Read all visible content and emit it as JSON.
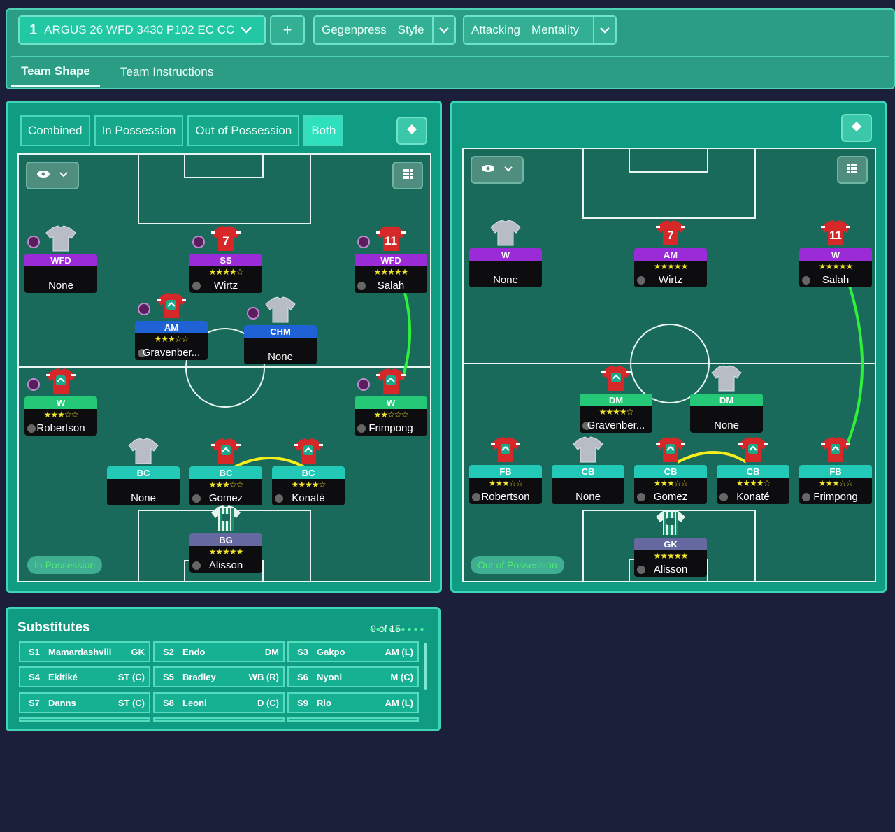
{
  "header": {
    "tactic_num": "1",
    "tactic_name": "ARGUS 26 WFD 3430 P102 EC CC",
    "plus": "+",
    "style_a": "Gegenpress",
    "style_b": "Style",
    "ment_a": "Attacking",
    "ment_b": "Mentality"
  },
  "tabs": [
    "Team Shape",
    "Team Instructions"
  ],
  "modes": [
    "Combined",
    "In Possession",
    "Out of Possession",
    "Both"
  ],
  "left_state": "In Possession",
  "right_state": "Out of Possession",
  "left_cards": [
    {
      "role": "WFD",
      "name": "None",
      "stars": "",
      "color": "purple",
      "shirt": "grey",
      "num": "",
      "dot": true
    },
    {
      "role": "SS",
      "name": "Wirtz",
      "stars": "★★★★☆",
      "color": "purple",
      "shirt": "red",
      "num": "7",
      "dot": true
    },
    {
      "role": "WFD",
      "name": "Salah",
      "stars": "★★★★★",
      "color": "purple",
      "shirt": "red",
      "num": "11",
      "dot": true
    },
    {
      "role": "AM",
      "name": "Gravenber...",
      "stars": "★★★☆☆",
      "color": "blue",
      "shirt": "red",
      "num": "",
      "dot": true
    },
    {
      "role": "CHM",
      "name": "None",
      "stars": "",
      "color": "blue",
      "shirt": "grey",
      "num": "",
      "dot": true
    },
    {
      "role": "W",
      "name": "Robertson",
      "stars": "★★★☆☆",
      "color": "green",
      "shirt": "red",
      "num": "",
      "dot": true
    },
    {
      "role": "W",
      "name": "Frimpong",
      "stars": "★★☆☆☆",
      "color": "green",
      "shirt": "red",
      "num": "",
      "dot": true
    },
    {
      "role": "BC",
      "name": "None",
      "stars": "",
      "color": "teal",
      "shirt": "grey",
      "num": "",
      "dot": false
    },
    {
      "role": "BC",
      "name": "Gomez",
      "stars": "★★★☆☆",
      "color": "teal",
      "shirt": "red",
      "num": "",
      "dot": false
    },
    {
      "role": "BC",
      "name": "Konaté",
      "stars": "★★★★☆",
      "color": "teal",
      "shirt": "red",
      "num": "",
      "dot": false
    },
    {
      "role": "BG",
      "name": "Alisson",
      "stars": "★★★★★",
      "color": "slate",
      "shirt": "gk",
      "num": "",
      "dot": false
    }
  ],
  "right_cards": [
    {
      "role": "W",
      "name": "None",
      "stars": "",
      "color": "purple",
      "shirt": "grey",
      "num": ""
    },
    {
      "role": "AM",
      "name": "Wirtz",
      "stars": "★★★★★",
      "color": "purple",
      "shirt": "red",
      "num": "7"
    },
    {
      "role": "W",
      "name": "Salah",
      "stars": "★★★★★",
      "color": "purple",
      "shirt": "red",
      "num": "11"
    },
    {
      "role": "DM",
      "name": "Gravenber...",
      "stars": "★★★★☆",
      "color": "green",
      "shirt": "red",
      "num": ""
    },
    {
      "role": "DM",
      "name": "None",
      "stars": "",
      "color": "green",
      "shirt": "grey",
      "num": ""
    },
    {
      "role": "FB",
      "name": "Robertson",
      "stars": "★★★☆☆",
      "color": "teal",
      "shirt": "red",
      "num": ""
    },
    {
      "role": "CB",
      "name": "None",
      "stars": "",
      "color": "teal",
      "shirt": "grey",
      "num": ""
    },
    {
      "role": "CB",
      "name": "Gomez",
      "stars": "★★★☆☆",
      "color": "teal",
      "shirt": "red",
      "num": ""
    },
    {
      "role": "CB",
      "name": "Konaté",
      "stars": "★★★★☆",
      "color": "teal",
      "shirt": "red",
      "num": ""
    },
    {
      "role": "FB",
      "name": "Frimpong",
      "stars": "★★★☆☆",
      "color": "teal",
      "shirt": "red",
      "num": ""
    },
    {
      "role": "GK",
      "name": "Alisson",
      "stars": "★★★★★",
      "color": "slate",
      "shirt": "gk",
      "num": ""
    }
  ],
  "subs": {
    "title": "Substitutes",
    "count": "9 of 15",
    "rows": [
      {
        "slot": "S1",
        "name": "Mamardashvili",
        "pos": "GK"
      },
      {
        "slot": "S2",
        "name": "Endo",
        "pos": "DM"
      },
      {
        "slot": "S3",
        "name": "Gakpo",
        "pos": "AM (L)"
      },
      {
        "slot": "S4",
        "name": "Ekitiké",
        "pos": "ST (C)"
      },
      {
        "slot": "S5",
        "name": "Bradley",
        "pos": "WB (R)"
      },
      {
        "slot": "S6",
        "name": "Nyoni",
        "pos": "M (C)"
      },
      {
        "slot": "S7",
        "name": "Danns",
        "pos": "ST (C)"
      },
      {
        "slot": "S8",
        "name": "Leoni",
        "pos": "D (C)"
      },
      {
        "slot": "S9",
        "name": "Rio",
        "pos": "AM (L)"
      }
    ]
  },
  "colors": {
    "purple": "#9b2bd6",
    "blue": "#1e62d6",
    "green": "#24c877",
    "teal": "#22c9b6",
    "slate": "#6668a0",
    "link_green": "#2ff03a",
    "link_yellow": "#f5ee1c"
  },
  "icons": [
    "chevron-down-icon",
    "plus-icon",
    "diamond-icon",
    "eye-icon",
    "grid-icon",
    "shirt-icon",
    "person-icon"
  ]
}
